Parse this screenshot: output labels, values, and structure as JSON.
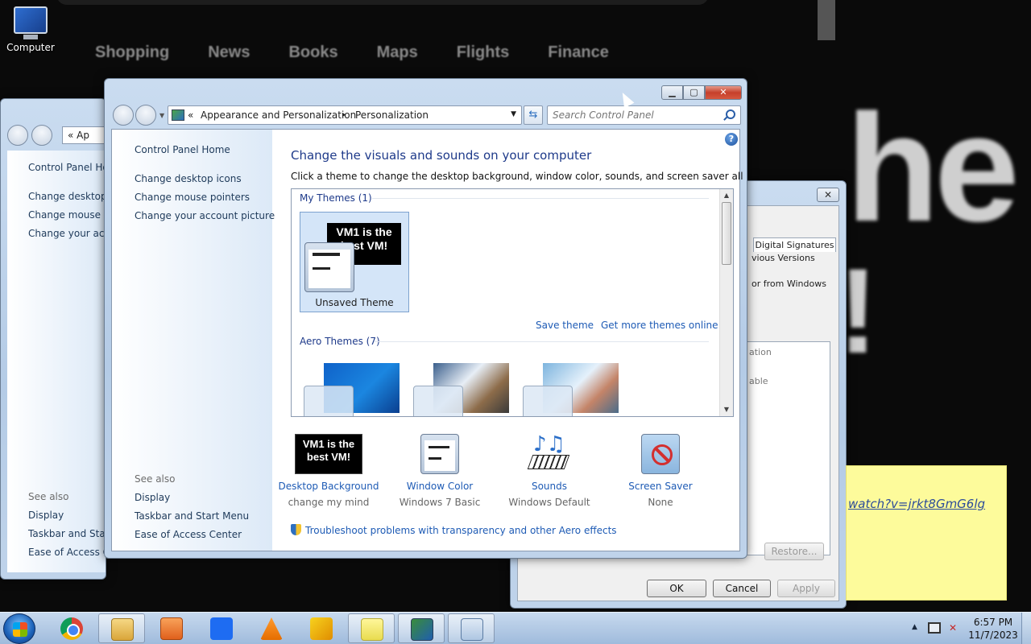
{
  "background": {
    "nav": [
      "Shopping",
      "News",
      "Books",
      "Maps",
      "Flights",
      "Finance"
    ],
    "big_text": "he",
    "big_text2": "!"
  },
  "desktop": {
    "computer_label": "Computer"
  },
  "left_window": {
    "address": "« Ap",
    "links": [
      "Control Panel Ho",
      "Change desktop i",
      "Change mouse p",
      "Change your acc"
    ],
    "see_also": "See also",
    "see_also_links": [
      "Display",
      "Taskbar and Start",
      "Ease of Access Ce"
    ]
  },
  "right_window": {
    "tab": "Digital Signatures",
    "line1": "vious Versions",
    "line2": "or from Windows",
    "frame_text1": "ation",
    "frame_text2": "able",
    "buttons": {
      "restore": "Restore...",
      "ok": "OK",
      "cancel": "Cancel",
      "apply": "Apply"
    }
  },
  "sticky_note": {
    "text": "watch?v=jrkt8GmG6lg"
  },
  "main_window": {
    "address": {
      "sep": "«",
      "crumb1": "Appearance and Personalization",
      "arrow": "▸",
      "crumb2": "Personalization"
    },
    "search_placeholder": "Search Control Panel",
    "left_pane": {
      "home": "Control Panel Home",
      "links": [
        "Change desktop icons",
        "Change mouse pointers",
        "Change your account picture"
      ],
      "see_also": "See also",
      "see_also_links": [
        "Display",
        "Taskbar and Start Menu",
        "Ease of Access Center"
      ]
    },
    "title": "Change the visuals and sounds on your computer",
    "description": "Click a theme to change the desktop background, window color, sounds, and screen saver all at once.",
    "my_themes_header": "My Themes (1)",
    "selected_theme": {
      "name": "Unsaved Theme",
      "preview_text": "VM1 is the best VM!"
    },
    "save_theme": "Save theme",
    "get_more": "Get more themes online",
    "aero_header": "Aero Themes (7)",
    "bottom": [
      {
        "title": "Desktop Background",
        "sub": "change my mind",
        "preview_text": "VM1 is the best VM!"
      },
      {
        "title": "Window Color",
        "sub": "Windows 7 Basic"
      },
      {
        "title": "Sounds",
        "sub": "Windows Default"
      },
      {
        "title": "Screen Saver",
        "sub": "None"
      }
    ],
    "troubleshoot": "Troubleshoot problems with transparency and other Aero effects",
    "help": "?"
  },
  "taskbar": {
    "items": [
      "start",
      "chrome",
      "windows-explorer",
      "media-player",
      "dropbox",
      "vlc",
      "pen-app",
      "sticky-notes",
      "display-settings",
      "control-panel"
    ],
    "clock": {
      "time": "6:57 PM",
      "date": "11/7/2023"
    }
  }
}
